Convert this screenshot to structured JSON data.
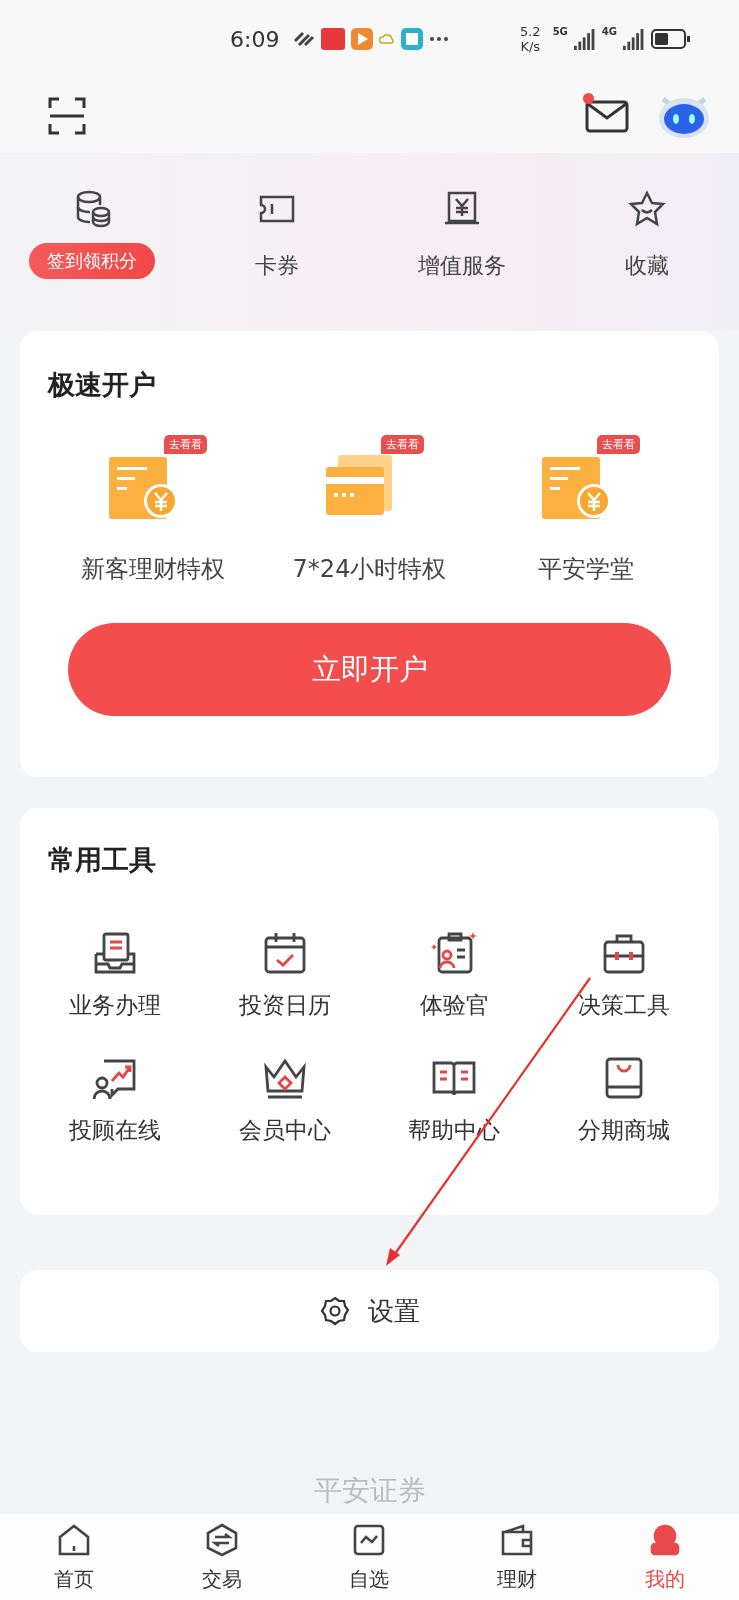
{
  "status_bar": {
    "time": "6:09",
    "speed_value": "5.2",
    "speed_unit": "K/s",
    "networks": [
      "5G",
      "4G"
    ]
  },
  "header": {
    "message_unread": true
  },
  "quick_links": [
    {
      "label": "签到领积分",
      "kind": "badge"
    },
    {
      "label": "卡券",
      "kind": "plain"
    },
    {
      "label": "增值服务",
      "kind": "plain"
    },
    {
      "label": "收藏",
      "kind": "plain"
    }
  ],
  "account_card": {
    "title": "极速开户",
    "features": [
      {
        "label": "新客理财特权",
        "tag": "去看看"
      },
      {
        "label": "7*24小时特权",
        "tag": "去看看"
      },
      {
        "label": "平安学堂",
        "tag": "去看看"
      }
    ],
    "button": "立即开户"
  },
  "tools_card": {
    "title": "常用工具",
    "items": [
      "业务办理",
      "投资日历",
      "体验官",
      "决策工具",
      "投顾在线",
      "会员中心",
      "帮助中心",
      "分期商城"
    ]
  },
  "settings": {
    "label": "设置"
  },
  "footer_brand": "平安证券",
  "tabs": [
    {
      "label": "首页",
      "selected": false
    },
    {
      "label": "交易",
      "selected": false
    },
    {
      "label": "自选",
      "selected": false
    },
    {
      "label": "理财",
      "selected": false
    },
    {
      "label": "我的",
      "selected": true
    }
  ]
}
